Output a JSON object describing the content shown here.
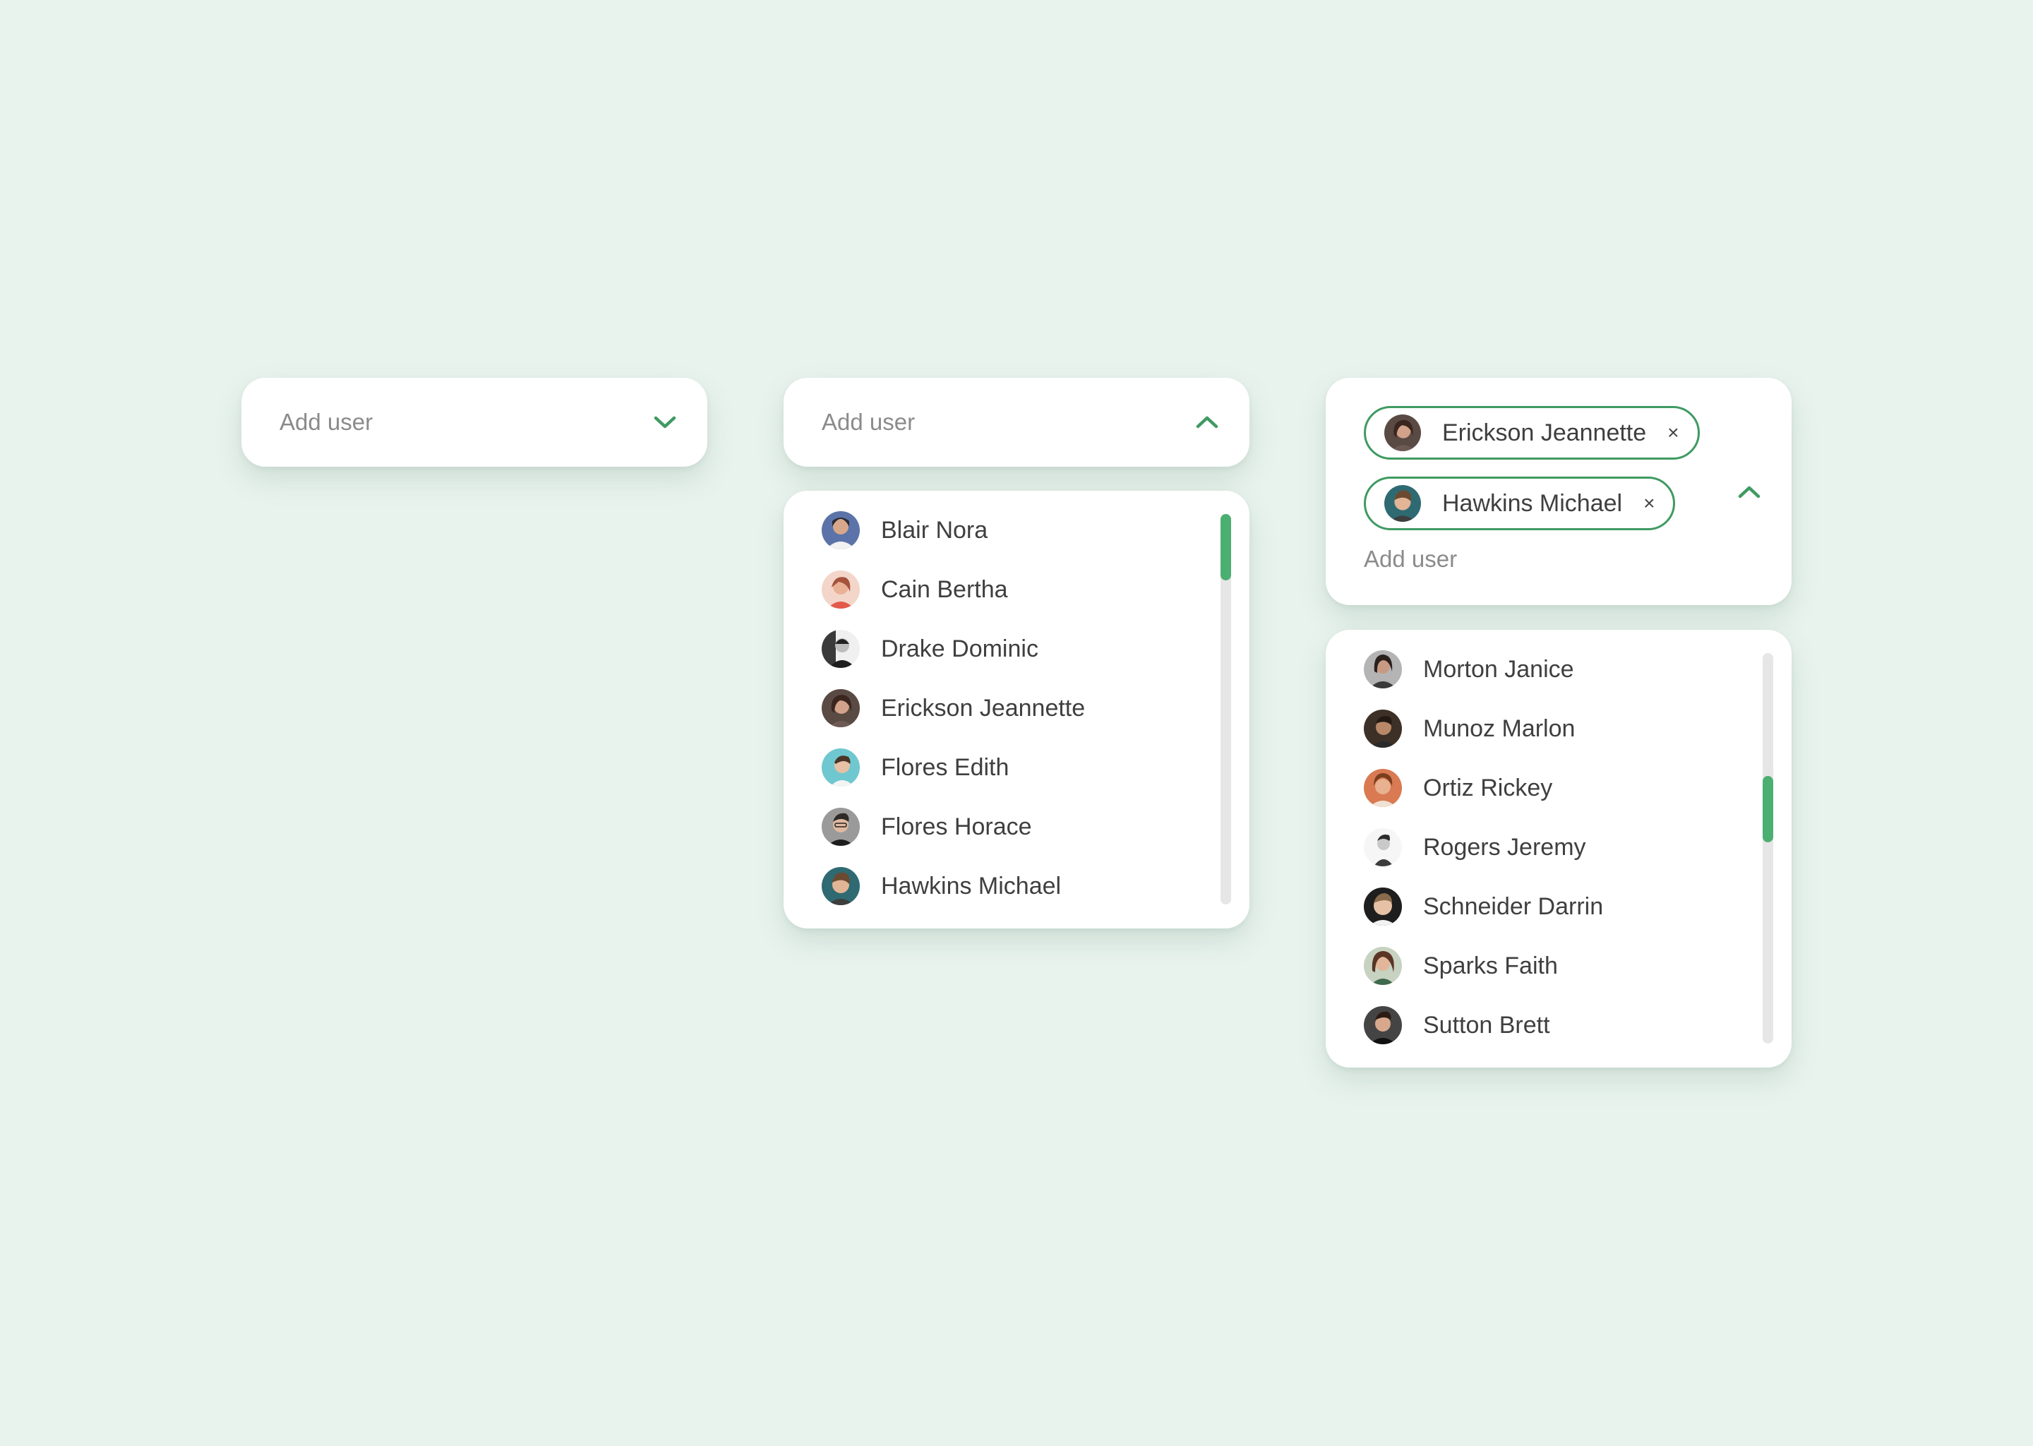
{
  "colors": {
    "background": "#e9f3ee",
    "accent": "#3f9a62",
    "card": "#ffffff",
    "scroll_track": "#e6e6e6",
    "scroll_thumb": "#4caf72",
    "text": "#3f3f3f",
    "placeholder": "#8b8b8b"
  },
  "select_closed": {
    "placeholder": "Add user",
    "icon": "chevron-down-icon"
  },
  "select_open": {
    "placeholder": "Add user",
    "icon": "chevron-up-icon",
    "scroll_position": 0.0,
    "items": [
      {
        "name": "Blair Nora",
        "avatar": "avatar-blair-nora"
      },
      {
        "name": "Cain Bertha",
        "avatar": "avatar-cain-bertha"
      },
      {
        "name": "Drake Dominic",
        "avatar": "avatar-drake-dominic"
      },
      {
        "name": "Erickson Jeannette",
        "avatar": "avatar-erickson-jeannette"
      },
      {
        "name": "Flores Edith",
        "avatar": "avatar-flores-edith"
      },
      {
        "name": "Flores Horace",
        "avatar": "avatar-flores-horace"
      },
      {
        "name": "Hawkins Michael",
        "avatar": "avatar-hawkins-michael"
      }
    ]
  },
  "select_multi": {
    "placeholder": "Add user",
    "icon": "chevron-up-icon",
    "remove_glyph": "×",
    "chips": [
      {
        "label": "Erickson Jeannette",
        "avatar": "avatar-erickson-jeannette"
      },
      {
        "label": "Hawkins Michael",
        "avatar": "avatar-hawkins-michael"
      }
    ],
    "scroll_position": 0.38,
    "items": [
      {
        "name": "Morton Janice",
        "avatar": "avatar-morton-janice"
      },
      {
        "name": "Munoz Marlon",
        "avatar": "avatar-munoz-marlon"
      },
      {
        "name": "Ortiz Rickey",
        "avatar": "avatar-ortiz-rickey"
      },
      {
        "name": "Rogers Jeremy",
        "avatar": "avatar-rogers-jeremy"
      },
      {
        "name": "Schneider Darrin",
        "avatar": "avatar-schneider-darrin"
      },
      {
        "name": "Sparks Faith",
        "avatar": "avatar-sparks-faith"
      },
      {
        "name": "Sutton Brett",
        "avatar": "avatar-sutton-brett"
      }
    ]
  }
}
